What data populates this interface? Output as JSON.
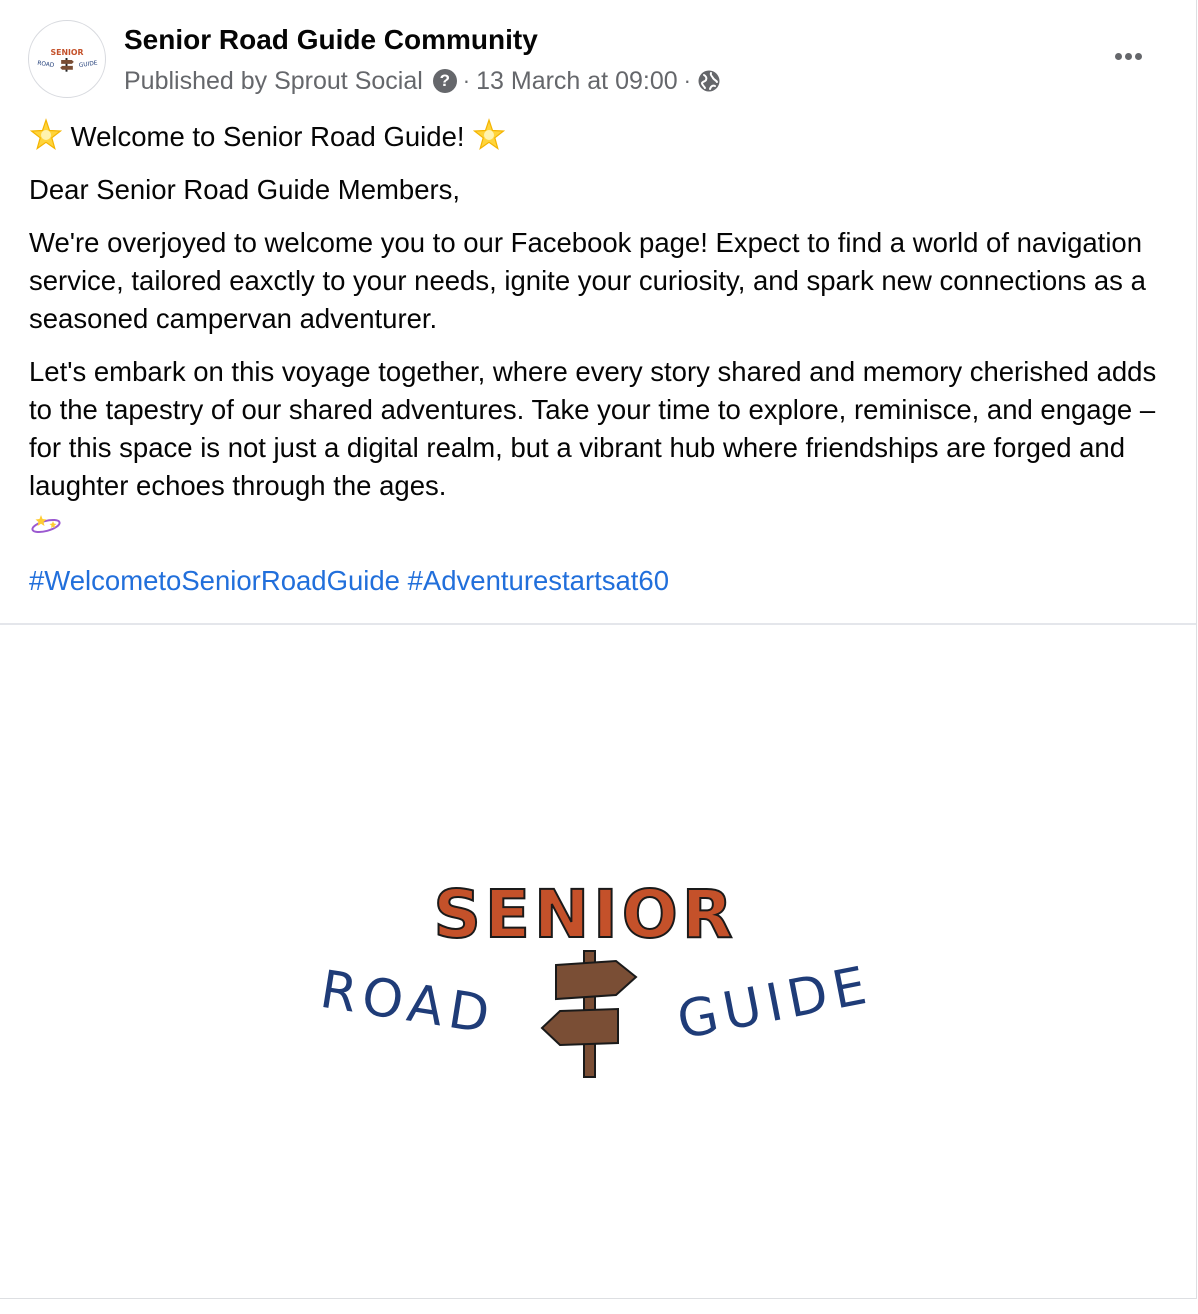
{
  "post": {
    "page_name": "Senior Road Guide Community",
    "published_by": "Published by Sprout Social",
    "help_icon": "question-mark-icon",
    "separator": "·",
    "timestamp": "13 March at 09:00",
    "audience_icon": "globe-icon",
    "more_icon": "ellipsis-icon",
    "welcome_line": "Welcome to Senior Road Guide!",
    "greeting": "Dear Senior Road Guide Members,",
    "paragraph_1": "We're overjoyed to welcome you to our Facebook page! Expect to find a world of navigation service, tailored eaxctly to your needs, ignite your curiosity, and spark new connections as a seasoned campervan adventurer.",
    "paragraph_2": "Let's embark on this voyage together, where every story shared and memory cherished adds to the tapestry of our shared adventures. Take your time to explore, reminisce, and engage – for this space is not just a digital realm, but a vibrant hub where friendships are forged and laughter echoes through the ages.",
    "hashtags": [
      "#WelcometoSeniorRoadGuide",
      "#Adventurestartsat60"
    ]
  },
  "logo": {
    "word_top": "SENIOR",
    "word_left": "ROAD",
    "word_right": "GUIDE",
    "colors": {
      "senior": "#c4512a",
      "road_guide": "#1f3c78",
      "signpost": "#7a4e35",
      "outline": "#1a1a1a"
    }
  }
}
